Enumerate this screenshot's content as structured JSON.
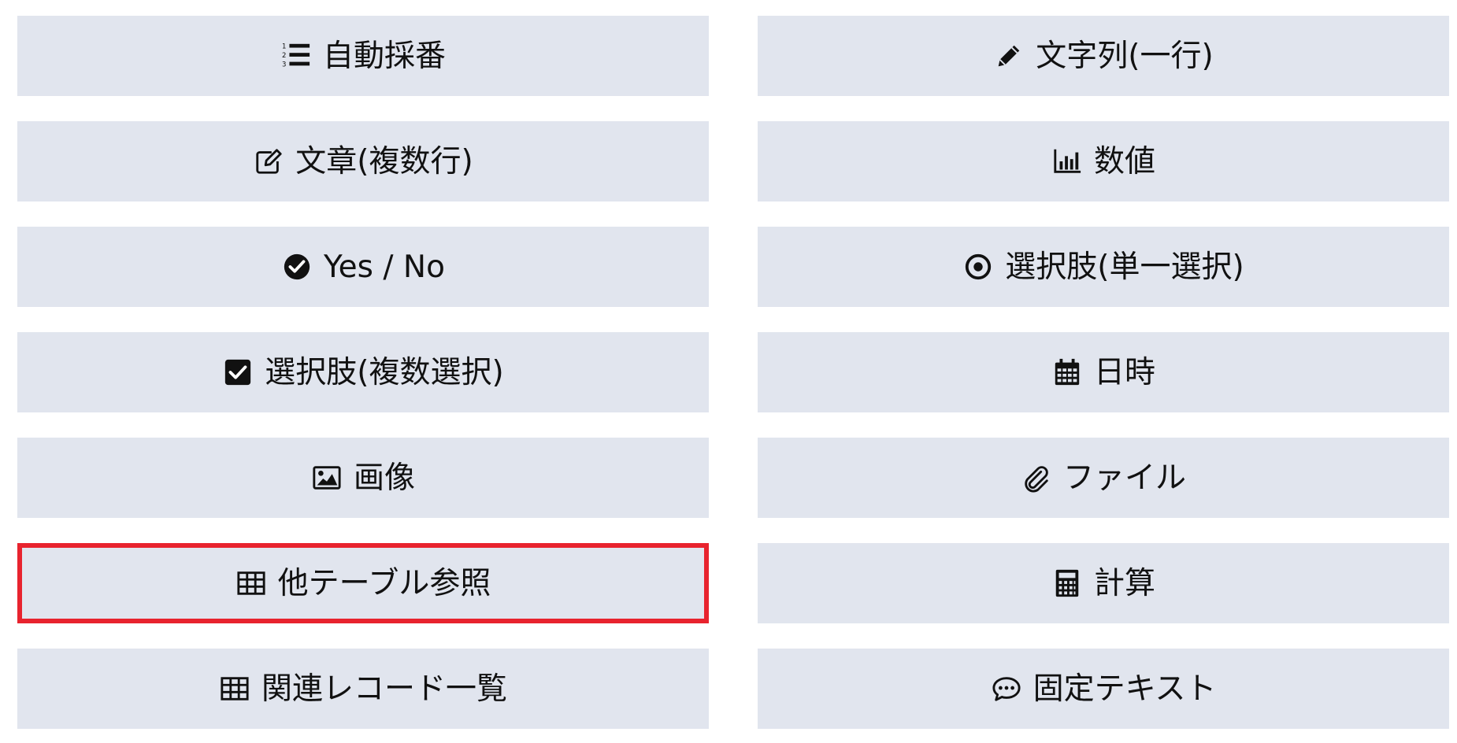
{
  "fields": [
    {
      "id": "auto-number",
      "label": "自動採番",
      "icon": "ordered-list-icon",
      "selected": false
    },
    {
      "id": "single-line-text",
      "label": "文字列(一行)",
      "icon": "pencil-icon",
      "selected": false
    },
    {
      "id": "multi-line-text",
      "label": "文章(複数行)",
      "icon": "edit-icon",
      "selected": false
    },
    {
      "id": "number",
      "label": "数値",
      "icon": "bar-chart-icon",
      "selected": false
    },
    {
      "id": "yes-no",
      "label": "Yes / No",
      "icon": "check-circle-icon",
      "selected": false
    },
    {
      "id": "single-choice",
      "label": "選択肢(単一選択)",
      "icon": "radio-dot-icon",
      "selected": false
    },
    {
      "id": "multi-choice",
      "label": "選択肢(複数選択)",
      "icon": "check-square-icon",
      "selected": false
    },
    {
      "id": "datetime",
      "label": "日時",
      "icon": "calendar-icon",
      "selected": false
    },
    {
      "id": "image",
      "label": "画像",
      "icon": "image-icon",
      "selected": false
    },
    {
      "id": "file",
      "label": "ファイル",
      "icon": "paperclip-icon",
      "selected": false
    },
    {
      "id": "table-reference",
      "label": "他テーブル参照",
      "icon": "table-icon",
      "selected": true
    },
    {
      "id": "calculation",
      "label": "計算",
      "icon": "calculator-icon",
      "selected": false
    },
    {
      "id": "related-records",
      "label": "関連レコード一覧",
      "icon": "table-icon",
      "selected": false
    },
    {
      "id": "fixed-text",
      "label": "固定テキスト",
      "icon": "comment-dots-icon",
      "selected": false
    }
  ],
  "colors": {
    "button_bg": "#e1e5ee",
    "selected_border": "#e8232e",
    "text": "#111111"
  }
}
